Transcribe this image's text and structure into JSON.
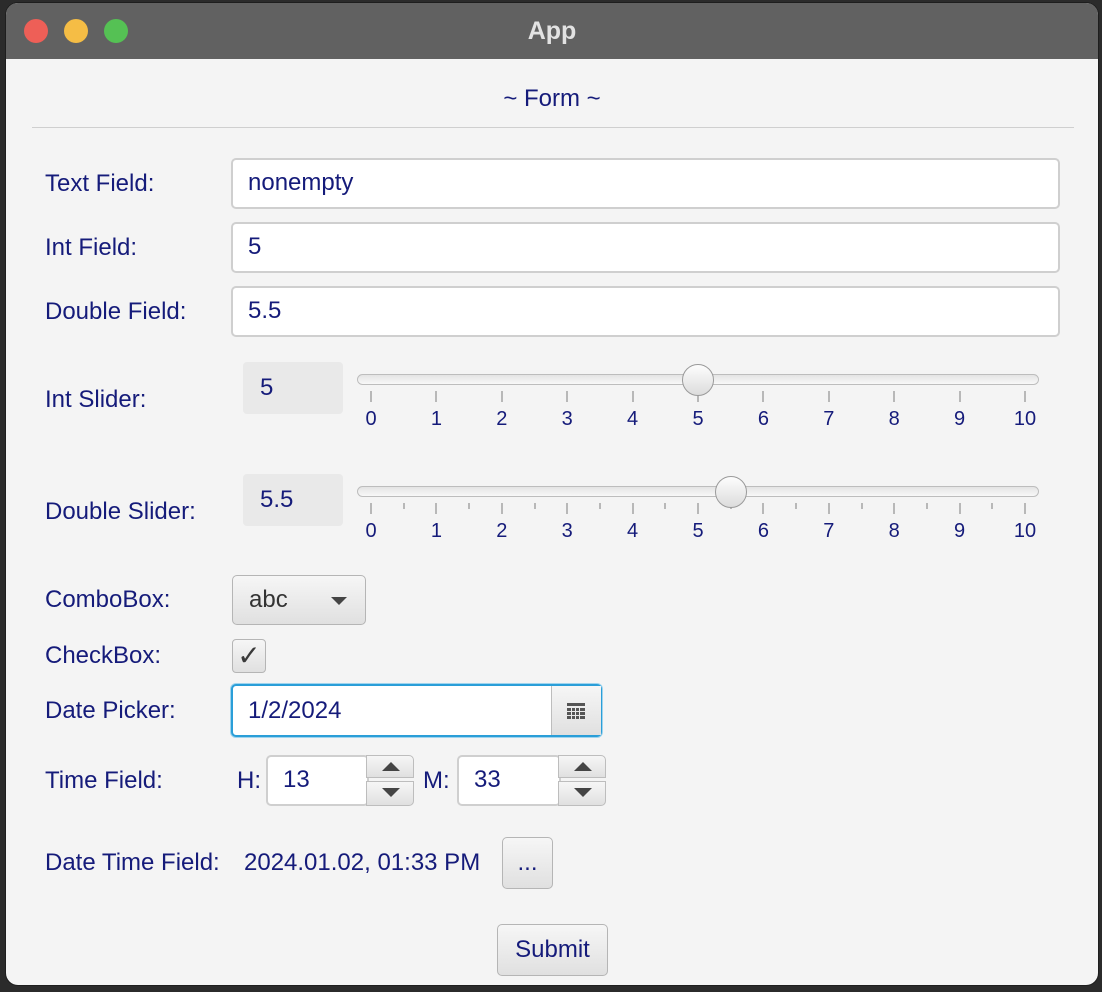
{
  "window": {
    "title": "App"
  },
  "form": {
    "title": "~ Form ~",
    "text_field": {
      "label": "Text Field:",
      "value": "nonempty"
    },
    "int_field": {
      "label": "Int Field:",
      "value": "5"
    },
    "double_field": {
      "label": "Double Field:",
      "value": "5.5"
    },
    "int_slider": {
      "label": "Int Slider:",
      "value_text": "5",
      "value": 5,
      "min": 0,
      "max": 10,
      "ticks": [
        "0",
        "1",
        "2",
        "3",
        "4",
        "5",
        "6",
        "7",
        "8",
        "9",
        "10"
      ]
    },
    "double_slider": {
      "label": "Double Slider:",
      "value_text": "5.5",
      "value": 5.5,
      "min": 0,
      "max": 10,
      "ticks": [
        "0",
        "1",
        "2",
        "3",
        "4",
        "5",
        "6",
        "7",
        "8",
        "9",
        "10"
      ]
    },
    "combo_box": {
      "label": "ComboBox:",
      "selected": "abc"
    },
    "check_box": {
      "label": "CheckBox:",
      "checked": true
    },
    "date_picker": {
      "label": "Date Picker:",
      "value": "1/2/2024"
    },
    "time_field": {
      "label": "Time Field:",
      "hour_label": "H:",
      "hour": "13",
      "minute_label": "M:",
      "minute": "33"
    },
    "date_time_field": {
      "label": "Date Time Field:",
      "value": "2024.01.02, 01:33 PM",
      "button_label": "..."
    },
    "submit_label": "Submit"
  },
  "icons": {
    "calendar": "calendar-icon",
    "check": "checkmark-icon"
  },
  "colors": {
    "text": "#151b7a",
    "focus": "#2a9ed8",
    "titlebar": "#616161"
  }
}
